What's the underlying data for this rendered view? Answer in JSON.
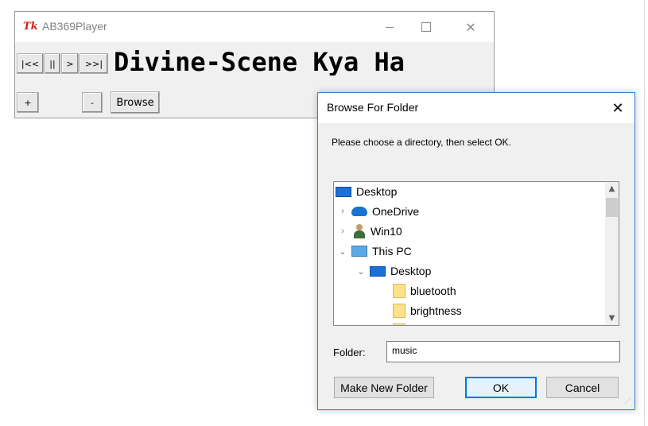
{
  "player": {
    "title": "AB369Player",
    "logo_text": "Tk",
    "controls": [
      "|<<",
      "||",
      ">",
      ">>|"
    ],
    "now_playing": "Divine-Scene Kya Ha",
    "vol_up": "+",
    "vol_down": "-",
    "browse_label": "Browse"
  },
  "dialog": {
    "title": "Browse For Folder",
    "close_glyph": "✕",
    "instructions": "Please choose a directory, then select OK.",
    "tree": [
      {
        "label": "Desktop",
        "icon": "desktop-icon",
        "expander": ""
      },
      {
        "label": "OneDrive",
        "icon": "cloud-icon",
        "expander": "›"
      },
      {
        "label": "Win10",
        "icon": "user-icon",
        "expander": "›"
      },
      {
        "label": "This PC",
        "icon": "computer-icon",
        "expander": "⌄"
      },
      {
        "label": "Desktop",
        "icon": "desktop-icon",
        "expander": "⌄"
      },
      {
        "label": "bluetooth",
        "icon": "folder-icon",
        "expander": ""
      },
      {
        "label": "brightness",
        "icon": "folder-icon",
        "expander": ""
      }
    ],
    "folder_label": "Folder:",
    "folder_value": "music",
    "make_new_folder": "Make New Folder",
    "ok": "OK",
    "cancel": "Cancel"
  },
  "colors": {
    "accent": "#0078d7",
    "window_bg": "#f0f0f0"
  }
}
